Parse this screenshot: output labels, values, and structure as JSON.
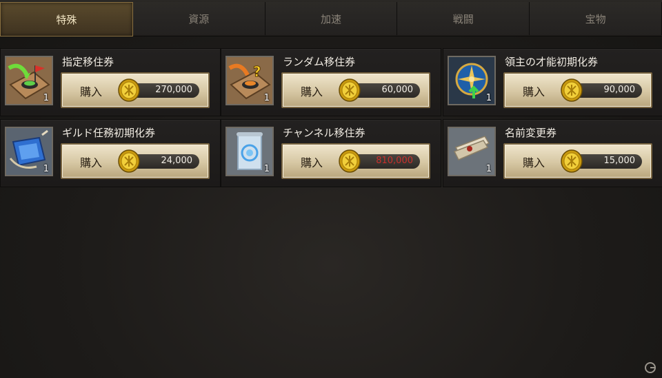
{
  "tabs": [
    {
      "label": "特殊",
      "active": true
    },
    {
      "label": "資源",
      "active": false
    },
    {
      "label": "加速",
      "active": false
    },
    {
      "label": "戦闘",
      "active": false
    },
    {
      "label": "宝物",
      "active": false
    }
  ],
  "items": [
    {
      "name": "指定移住券",
      "quantity": "1",
      "buy_label": "購入",
      "price": "270,000",
      "price_color": "#f2eee6",
      "icon": "targeted-relocation-icon"
    },
    {
      "name": "ランダム移住券",
      "quantity": "1",
      "buy_label": "購入",
      "price": "60,000",
      "price_color": "#f2eee6",
      "icon": "random-relocation-icon"
    },
    {
      "name": "領主の才能初期化券",
      "quantity": "1",
      "buy_label": "購入",
      "price": "90,000",
      "price_color": "#f2eee6",
      "icon": "talent-reset-icon"
    },
    {
      "name": "ギルド任務初期化券",
      "quantity": "1",
      "buy_label": "購入",
      "price": "24,000",
      "price_color": "#f2eee6",
      "icon": "guild-quest-reset-icon"
    },
    {
      "name": "チャンネル移住券",
      "quantity": "1",
      "buy_label": "購入",
      "price": "810,000",
      "price_color": "#c9302c",
      "icon": "channel-relocation-icon"
    },
    {
      "name": "名前変更券",
      "quantity": "1",
      "buy_label": "購入",
      "price": "15,000",
      "price_color": "#f2eee6",
      "icon": "rename-scroll-icon"
    }
  ],
  "currency_icon": "gold-coin-icon",
  "colors": {
    "accent": "#8a7040",
    "insufficient_price": "#c9302c"
  }
}
